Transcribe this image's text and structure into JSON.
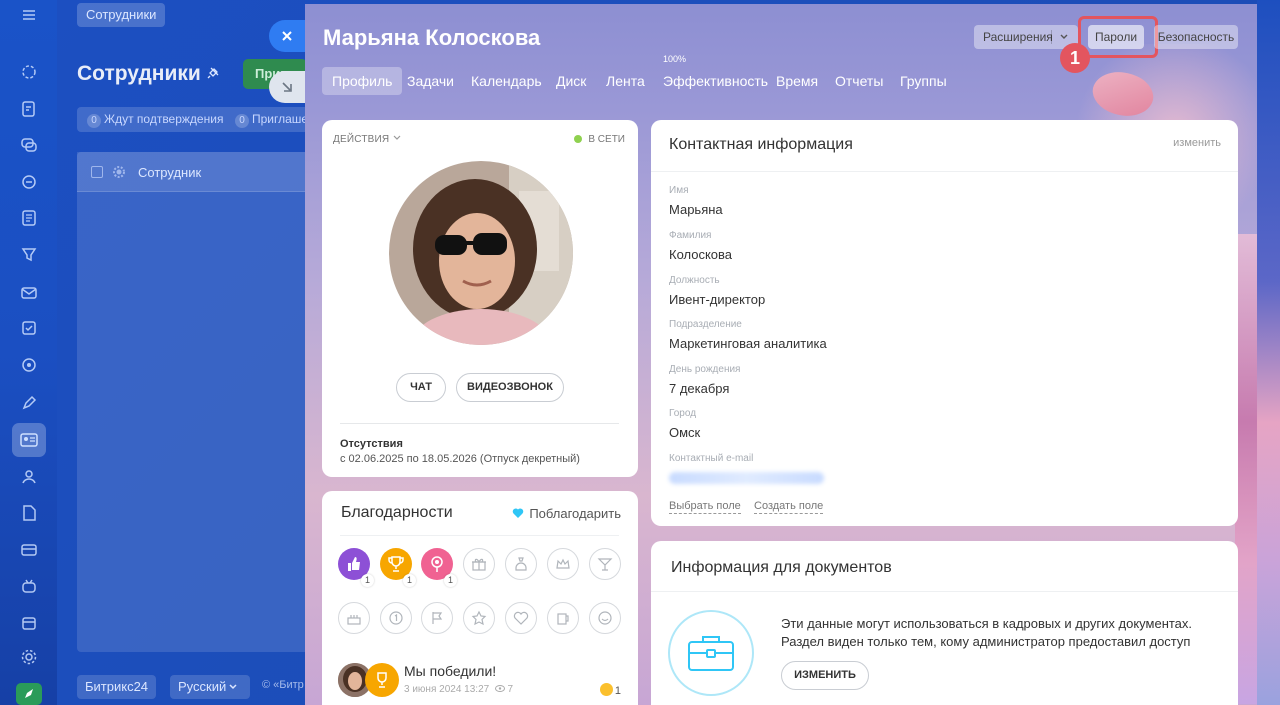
{
  "bg": {
    "breadcrumb": "Сотрудники",
    "title": "Сотрудники",
    "primary_button": "Приг",
    "filters": [
      {
        "count": "0",
        "label": "Ждут подтверждения"
      },
      {
        "count": "0",
        "label": "Приглаше"
      }
    ],
    "grid_header": "Сотрудник",
    "footer": {
      "brand": "Битрикс24",
      "lang": "Русский",
      "copyright": "© «Битр"
    }
  },
  "profile": {
    "name": "Марьяна Колоскова",
    "header_buttons": {
      "extensions": "Расширения",
      "passwords": "Пароли",
      "security": "Безопасность"
    },
    "callout_number": "1",
    "tabs": [
      {
        "label": "Профиль"
      },
      {
        "label": "Задачи"
      },
      {
        "label": "Календарь"
      },
      {
        "label": "Диск"
      },
      {
        "label": "Лента"
      },
      {
        "label": "Эффективность",
        "sup": "100%"
      },
      {
        "label": "Время"
      },
      {
        "label": "Отчеты"
      },
      {
        "label": "Группы"
      }
    ],
    "card": {
      "actions": "Действия",
      "status": "В сети",
      "chat_button": "Чат",
      "video_button": "Видеозвонок",
      "absence_title": "Отсутствия",
      "absence_text": "с 02.06.2025 по 18.05.2026 (Отпуск декретный)"
    },
    "thanks": {
      "title": "Благодарности",
      "action": "Поблагодарить",
      "badges": [
        {
          "icon": "thumbs-up-icon",
          "count": "1",
          "color": "#8d50d6"
        },
        {
          "icon": "trophy-icon",
          "count": "1",
          "color": "#f7a600"
        },
        {
          "icon": "flower-icon",
          "count": "1",
          "color": "#f06292"
        }
      ],
      "empty_badges_row1": [
        "gift-icon",
        "money-bag-icon",
        "crown-icon",
        "cocktail-icon"
      ],
      "empty_badges_row2": [
        "cake-icon",
        "number-one-icon",
        "flag-icon",
        "star-icon",
        "heart-icon",
        "beer-icon",
        "smile-icon"
      ],
      "post": {
        "title": "Мы победили!",
        "date": "3 июня 2024 13:27",
        "views": "7",
        "reactions": "1"
      }
    },
    "contact": {
      "title": "Контактная информация",
      "edit": "изменить",
      "fields": [
        {
          "label": "Имя",
          "value": "Марьяна"
        },
        {
          "label": "Фамилия",
          "value": "Колоскова"
        },
        {
          "label": "Должность",
          "value": "Ивент-директор"
        },
        {
          "label": "Подразделение",
          "value": "Маркетинговая аналитика"
        },
        {
          "label": "День рождения",
          "value": "7 декабря"
        },
        {
          "label": "Город",
          "value": "Омск"
        },
        {
          "label": "Контактный e-mail",
          "value": ""
        }
      ],
      "select_field": "Выбрать поле",
      "create_field": "Создать поле"
    },
    "docs": {
      "title": "Информация для документов",
      "line1": "Эти данные могут использоваться в кадровых и других документах.",
      "line2": "Раздел виден только тем, кому администратор предоставил доступ",
      "button": "Изменить"
    }
  },
  "colors": {
    "accent": "#2fc6f6",
    "highlight": "#e3555f",
    "online": "#8fd14f",
    "brand_blue": "#1a53c8"
  }
}
